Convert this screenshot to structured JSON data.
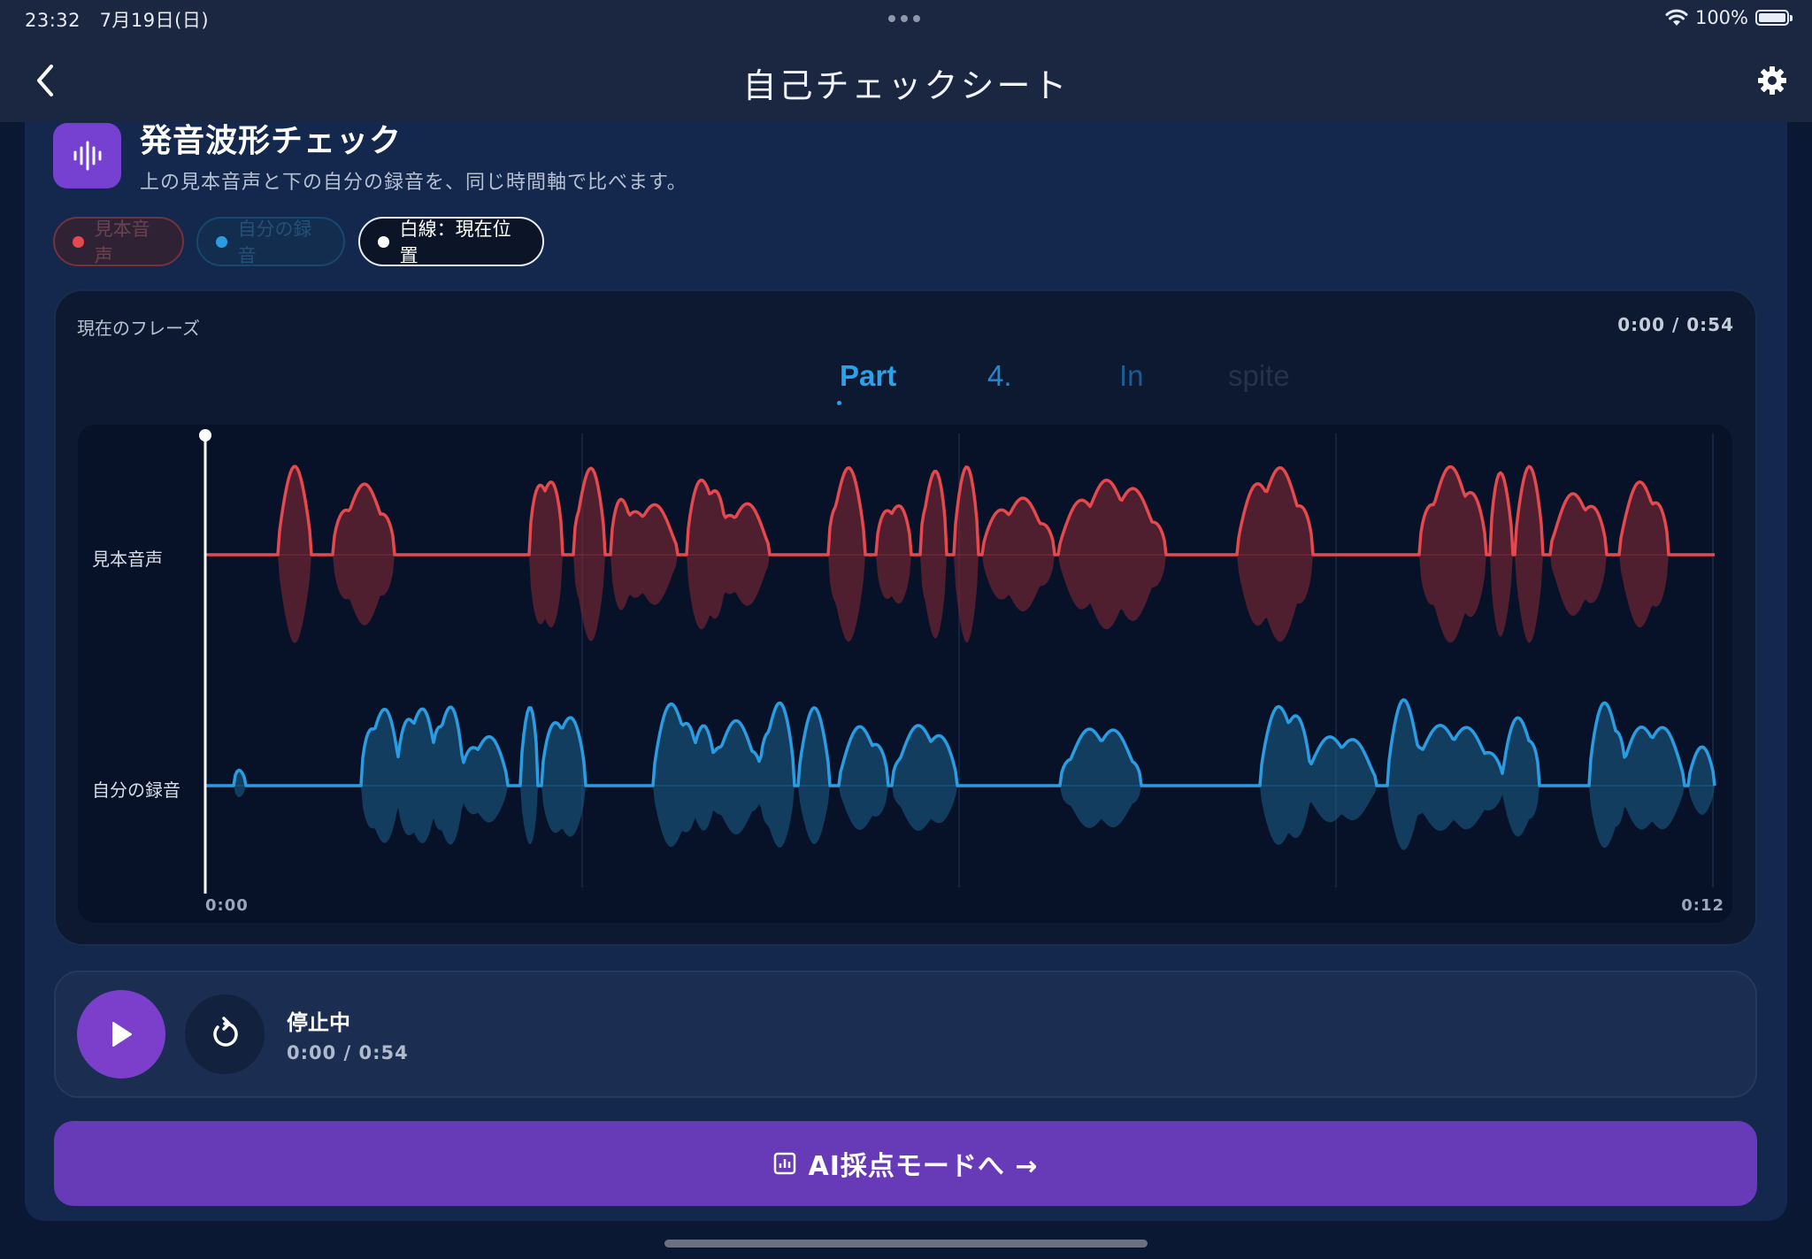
{
  "status_bar": {
    "time": "23:32",
    "date": "7月19日(日)",
    "battery": "100%",
    "icons": [
      "wifi-icon",
      "battery-icon"
    ]
  },
  "nav": {
    "title": "自己チェックシート",
    "back_icon": "chevron-left-icon",
    "settings_icon": "gear-icon"
  },
  "header": {
    "icon": "waveform-icon",
    "title": "発音波形チェック",
    "subtitle": "上の見本音声と下の自分の録音を、同じ時間軸で比べます。"
  },
  "legend": [
    {
      "label": "見本音声",
      "color": "#e5484d"
    },
    {
      "label": "自分の録音",
      "color": "#2a9de2"
    },
    {
      "label": "白線：現在位置",
      "color": "#ffffff"
    }
  ],
  "phrase": {
    "label": "現在のフレーズ",
    "time": "0:00 / 0:54",
    "words": [
      "Part",
      "4.",
      "In",
      "spite"
    ]
  },
  "waveform": {
    "lanes": [
      {
        "label": "見本音声",
        "color": "#e5484d"
      },
      {
        "label": "自分の録音",
        "color": "#2a9de2"
      }
    ],
    "time_start": "0:00",
    "time_end": "0:12"
  },
  "player": {
    "status": "停止中",
    "time": "0:00 / 0:54",
    "play_icon": "play-icon",
    "replay_icon": "replay-icon"
  },
  "ai_button": {
    "label": "AI採点モードへ →",
    "icon": "chart-icon"
  },
  "colors": {
    "accent_purple": "#673ab8",
    "ref_red": "#e5484d",
    "user_blue": "#2a9de2",
    "background": "#0b1833"
  }
}
